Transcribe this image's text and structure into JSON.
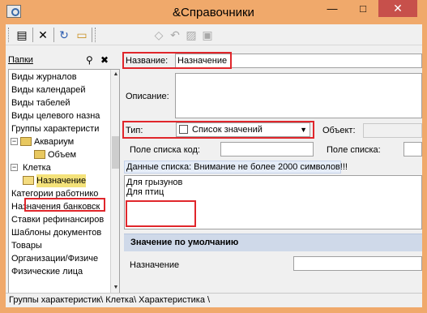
{
  "window": {
    "title": "&Справочники",
    "minimize_glyph": "—",
    "maximize_glyph": "□",
    "close_glyph": "✕"
  },
  "toolbar": {
    "icons": [
      "list-icon",
      "delete-icon",
      "refresh-icon",
      "open-folder-icon",
      "eraser-icon",
      "undo-icon",
      "paste-icon",
      "copy-icon"
    ],
    "glyphs": {
      "list": "▤",
      "delete": "✕",
      "refresh": "↻",
      "folder": "▭",
      "eraser": "◇",
      "undo": "↶",
      "paste": "▨",
      "copy": "▣"
    }
  },
  "left_panel": {
    "title": "Папки",
    "binoc_glyph": "⚲",
    "pin_glyph": "✖",
    "tree": [
      {
        "label": "Виды журналов",
        "level": 0
      },
      {
        "label": "Виды календарей",
        "level": 0
      },
      {
        "label": "Виды табелей",
        "level": 0
      },
      {
        "label": "Виды целевого назна",
        "level": 0
      },
      {
        "label": "Группы характеристи",
        "level": 0
      },
      {
        "label": "Аквариум",
        "level": 0,
        "toggle": "−",
        "folder": true
      },
      {
        "label": "Объем",
        "level": 1,
        "folder": true
      },
      {
        "label": "Клетка",
        "level": 0,
        "toggle": "−",
        "folder": true
      },
      {
        "label": "Назначение",
        "level": 1,
        "folder": true,
        "selected": true
      },
      {
        "label": "Категории работнико",
        "level": 0
      },
      {
        "label": "Назначения банковск",
        "level": 0
      },
      {
        "label": "Ставки рефинансиров",
        "level": 0
      },
      {
        "label": "Шаблоны документов",
        "level": 0
      },
      {
        "label": "Товары",
        "level": 0
      },
      {
        "label": "Организации/Физиче",
        "level": 0
      },
      {
        "label": "Физические лица",
        "level": 0
      }
    ],
    "scroll_up_glyph": "▲",
    "scroll_down_glyph": "▼"
  },
  "form": {
    "name_label": "Название:",
    "name_value": "Назначение",
    "description_label": "Описание:",
    "description_value": "",
    "type_label": "Тип:",
    "type_value": "Список значений",
    "type_arrow": "▼",
    "object_label": "Объект:",
    "object_value": "",
    "list_code_label": "Поле списка код:",
    "list_code_value": "",
    "list_field_label": "Поле списка:",
    "list_field_value": "",
    "list_data_info": "Данные списка: Внимание не более 2000 символов!!!",
    "list_items": [
      "Для грызунов",
      "Для птиц"
    ],
    "default_section": "Значение по умолчанию",
    "default_label": "Назначение",
    "default_value": ""
  },
  "status_bar": {
    "path": "Группы характеристик\\ Клетка\\ Характеристика \\"
  },
  "colors": {
    "highlight": "#e0262b",
    "title_bar": "#f0a96b",
    "close_button": "#c7504b",
    "selected_item": "#f4e27a",
    "section_header": "#cfd9e9"
  }
}
